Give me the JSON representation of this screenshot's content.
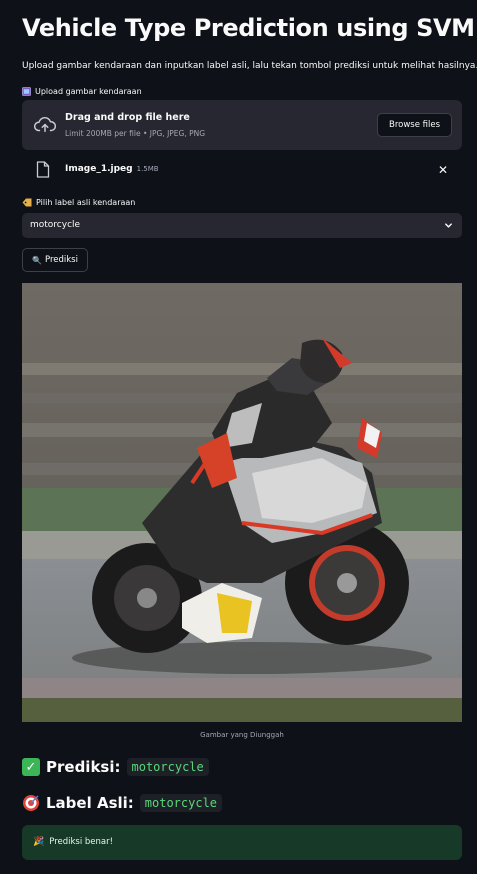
{
  "page_title": "Vehicle Type Prediction using SVM",
  "subtitle": "Upload gambar kendaraan dan inputkan label asli, lalu tekan tombol prediksi untuk melihat hasilnya.",
  "uploader": {
    "label": "Upload gambar kendaraan",
    "drop_text": "Drag and drop file here",
    "limit_text": "Limit 200MB per file • JPG, JPEG, PNG",
    "browse_label": "Browse files",
    "file_name": "Image_1.jpeg",
    "file_size": "1.5MB"
  },
  "label_select": {
    "label": "Pilih label asli kendaraan",
    "value": "motorcycle"
  },
  "predict_button": {
    "icon": "🔍",
    "label": "Prediksi"
  },
  "image": {
    "caption": "Gambar yang Diunggah"
  },
  "results": {
    "prediction_label": "Prediksi:",
    "prediction_value": "motorcycle",
    "true_label": "Label Asli:",
    "true_value": "motorcycle"
  },
  "success_message": {
    "icon": "🎉",
    "text": "Prediksi benar!"
  },
  "colors": {
    "background": "#0e1117",
    "widget": "#262730",
    "code_green": "#5ad77a",
    "success_bg": "#173928"
  }
}
